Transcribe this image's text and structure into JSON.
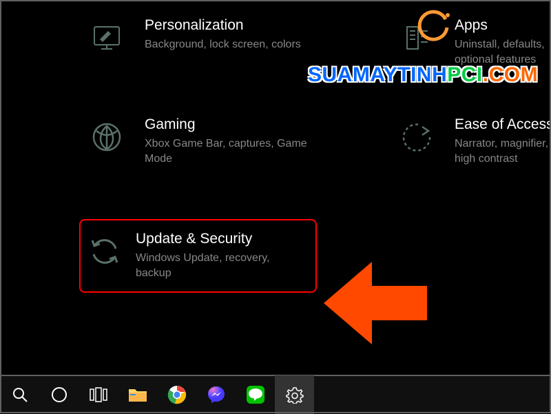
{
  "tiles": {
    "personalization": {
      "title": "Personalization",
      "desc": "Background, lock screen, colors"
    },
    "apps": {
      "title": "Apps",
      "desc": "Uninstall, defaults, optional features"
    },
    "gaming": {
      "title": "Gaming",
      "desc": "Xbox Game Bar, captures, Game Mode"
    },
    "ease": {
      "title": "Ease of Access",
      "desc": "Narrator, magnifier, high contrast"
    },
    "update": {
      "title": "Update & Security",
      "desc": "Windows Update, recovery, backup"
    }
  },
  "watermark": {
    "part1": "SUAMAYTINH",
    "part2": "PCI",
    "part3": ".COM"
  },
  "taskbar_icons": [
    "search",
    "cortana",
    "taskview",
    "explorer",
    "chrome",
    "messenger",
    "line",
    "settings"
  ],
  "colors": {
    "highlight": "#ff0000",
    "arrow": "#ff4800",
    "iconStroke": "#5a7268"
  }
}
